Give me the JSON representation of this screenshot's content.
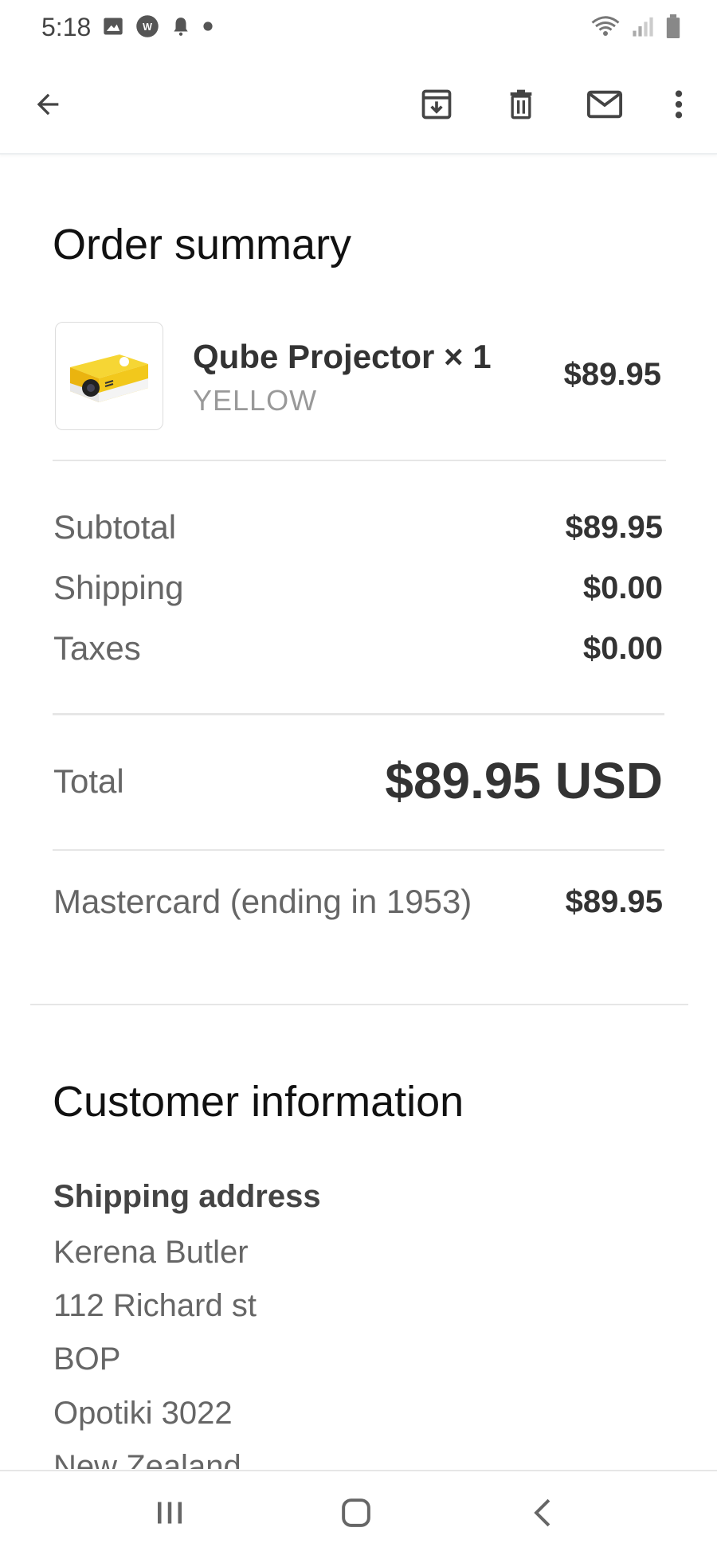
{
  "status_bar": {
    "time": "5:18"
  },
  "toolbar": {
    "back_icon": "arrow-left-icon",
    "archive_icon": "archive-icon",
    "delete_icon": "trash-icon",
    "mark_unread_icon": "mail-icon",
    "more_icon": "more-vert-icon"
  },
  "order_summary": {
    "title": "Order summary",
    "item": {
      "name": "Qube Projector × 1",
      "variant": "YELLOW",
      "price": "$89.95"
    },
    "subtotal": {
      "label": "Subtotal",
      "value": "$89.95"
    },
    "shipping": {
      "label": "Shipping",
      "value": "$0.00"
    },
    "taxes": {
      "label": "Taxes",
      "value": "$0.00"
    },
    "total": {
      "label": "Total",
      "value": "$89.95 USD"
    },
    "payment": {
      "label": "Mastercard (ending in 1953)",
      "value": "$89.95"
    }
  },
  "customer_info": {
    "title": "Customer information",
    "shipping_heading": "Shipping address",
    "address_lines": [
      "Kerena Butler",
      "112 Richard st",
      "BOP",
      "Opotiki 3022",
      "New Zealand"
    ]
  },
  "colors": {
    "text_primary": "#202124",
    "text_secondary": "#666666",
    "divider": "#e6e6e6",
    "product_yellow": "#f2c81c"
  }
}
